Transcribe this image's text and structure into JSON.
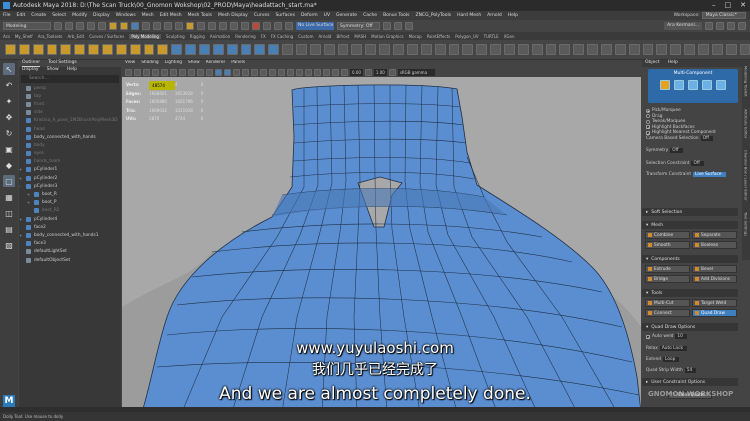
{
  "window": {
    "title": "Autodesk Maya 2018: D:\\The Scan Truck\\00_Gnomon Wokshop\\02_PROD\\Maya\\headattach_start.ma*"
  },
  "menubar": [
    "File",
    "Edit",
    "Create",
    "Select",
    "Modify",
    "Display",
    "Windows",
    "Mesh",
    "Edit Mesh",
    "Mesh Tools",
    "Mesh Display",
    "Curves",
    "Surfaces",
    "Deform",
    "UV",
    "Generate",
    "Cache",
    "Bonus Tools",
    "ZNCG_PolyTools",
    "Hard Mesh",
    "Arnold",
    "Help"
  ],
  "workspace": {
    "label": "Workspace:",
    "value": "Maya Classic*"
  },
  "statusline": {
    "mode": "Modeling",
    "live": "No Live Surface",
    "symmetry": "Symmetry: Off",
    "user": "Ara Kermanl..."
  },
  "shelf_tabs": [
    "Ara",
    "My_Shelf",
    "Ara_Toolsets",
    "Arb_Edit",
    "Curves / Surfaces",
    "Poly Modeling",
    "Sculpting",
    "Rigging",
    "Animation",
    "Rendering",
    "FX",
    "FX Caching",
    "Custom",
    "Arnold",
    "Bifrost",
    "MASH",
    "Motion Graphics",
    "Mocap",
    "PaintEffects",
    "Polygon_UV",
    "TURTLE",
    "XGen"
  ],
  "outliner": {
    "tabs": [
      "Outliner",
      "Tool Settings"
    ],
    "menu": [
      "Display",
      "Show",
      "Help"
    ],
    "search_placeholder": "Search...",
    "items": [
      {
        "label": "persp",
        "type": "cam",
        "dim": true,
        "expand": ""
      },
      {
        "label": "top",
        "type": "cam",
        "dim": true,
        "expand": ""
      },
      {
        "label": "front",
        "type": "cam",
        "dim": true,
        "expand": ""
      },
      {
        "label": "side",
        "type": "cam",
        "dim": true,
        "expand": ""
      },
      {
        "label": "Kristina_A_pose_1M2BrushPolyMesh3D",
        "type": "mesh",
        "dim": true,
        "expand": ""
      },
      {
        "label": "head",
        "type": "mesh",
        "dim": true,
        "expand": ""
      },
      {
        "label": "body_connected_with_hands",
        "type": "mesh",
        "dim": false,
        "expand": ""
      },
      {
        "label": "body",
        "type": "mesh",
        "dim": true,
        "expand": ""
      },
      {
        "label": "eyes",
        "type": "mesh",
        "dim": true,
        "expand": ""
      },
      {
        "label": "hands_team",
        "type": "mesh",
        "dim": true,
        "expand": ""
      },
      {
        "label": "pCylinder1",
        "type": "mesh",
        "dim": false,
        "expand": "+"
      },
      {
        "label": "pCylinder2",
        "type": "mesh",
        "dim": false,
        "expand": "+"
      },
      {
        "label": "pCylinder3",
        "type": "mesh",
        "dim": false,
        "expand": "-"
      },
      {
        "label": "boot_R",
        "type": "mesh",
        "dim": false,
        "expand": "+"
      },
      {
        "label": "boot_P",
        "type": "mesh",
        "dim": false,
        "expand": "+"
      },
      {
        "label": "boot_R2",
        "type": "mesh",
        "dim": true,
        "expand": ""
      },
      {
        "label": "pCylinder4",
        "type": "mesh",
        "dim": false,
        "expand": "+"
      },
      {
        "label": "face2",
        "type": "mesh",
        "dim": false,
        "expand": ""
      },
      {
        "label": "body_connected_with_hands1",
        "type": "mesh",
        "dim": false,
        "expand": "+"
      },
      {
        "label": "face3",
        "type": "mesh",
        "dim": false,
        "expand": ""
      },
      {
        "label": "defaultLightSet",
        "type": "set",
        "dim": false,
        "expand": ""
      },
      {
        "label": "defaultObjectSet",
        "type": "set",
        "dim": false,
        "expand": ""
      }
    ]
  },
  "viewport": {
    "menu": [
      "View",
      "Shading",
      "Lighting",
      "Show",
      "Renderer",
      "Panels"
    ],
    "exposure": "0.00",
    "gamma": "1.00",
    "colorspace": "sRGB gamma",
    "hud": [
      [
        "Verts:",
        "48574",
        "4",
        "0"
      ],
      [
        "Edges:",
        "1668601",
        "3053928",
        "0"
      ],
      [
        "Faces:",
        "1660880",
        "1601796",
        "0"
      ],
      [
        "Tris:",
        "1669032",
        "3311928",
        "0"
      ],
      [
        "UVs:",
        "5870",
        "4744",
        "0"
      ]
    ]
  },
  "subtitles": {
    "url": "www.yuyulaoshi.com",
    "zh": "我们几乎已经完成了",
    "en": "And we are almost completely done."
  },
  "attribute_panel": {
    "tabs": [
      "Object",
      "Help"
    ],
    "mc_title": "Multi-Component",
    "options": [
      {
        "label": "Pick/Marquee",
        "type": "radio",
        "checked": true
      },
      {
        "label": "Drag",
        "type": "radio",
        "checked": false
      },
      {
        "label": "Tweak/Marquee",
        "type": "radio",
        "checked": false
      },
      {
        "label": "Highlight Backfaces",
        "type": "check",
        "checked": true
      },
      {
        "label": "Highlight Nearest Component",
        "type": "check",
        "checked": true
      }
    ],
    "camera_based_label": "Camera Based Selection",
    "camera_based_value": "Off",
    "symmetry_label": "Symmetry",
    "symmetry_value": "Off",
    "selection_constraint_label": "Selection Constraint",
    "selection_constraint_value": "Off",
    "transform_constraint_label": "Transform Constraint",
    "transform_constraint_value": "Live Surface",
    "sections": {
      "soft": "Soft Selection",
      "mesh": "Mesh",
      "components": "Components",
      "tools": "Tools",
      "quad": "Quad Draw Options",
      "user": "User Constraint Options"
    },
    "mesh_btns": [
      "Combine",
      "Separate",
      "Smooth",
      "Boolean"
    ],
    "comp_btns": [
      "Extrude",
      "Bevel",
      "Bridge",
      "Add Divisions"
    ],
    "tool_btns": [
      "Multi-Cut",
      "Target Weld",
      "Connect",
      "Quad Draw"
    ],
    "auto_weld": "Auto weld",
    "auto_weld_value": "10",
    "relax_label": "Relax",
    "relax_value": "Auto Lock",
    "extend_label": "Extend",
    "extend_value": "Loop",
    "strip_label": "Quad Strip Width",
    "strip_value": "54",
    "clear_btn": "Clear Quads"
  },
  "side_tabs": [
    "Modeling Toolkit",
    "Attribute Editor",
    "Channel Box / Layer Editor",
    "Tool Settings"
  ],
  "watermark": "GNOMON WORKSHOP",
  "helpline": "Dolly Tool: Use mouse to dolly",
  "colors": {
    "mesh_blue": "#5b8ed0",
    "accent": "#3d7fbf",
    "mc_blue": "#2f6aa8"
  }
}
